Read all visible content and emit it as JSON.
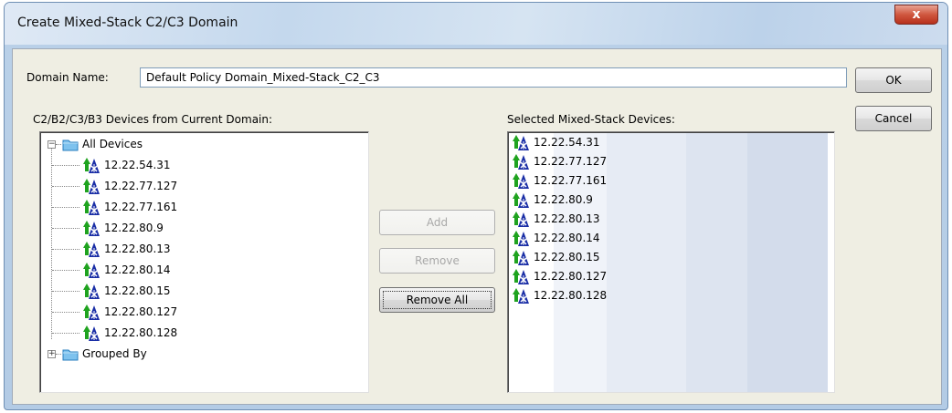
{
  "window": {
    "title": "Create Mixed-Stack C2/C3 Domain",
    "close_glyph": "x"
  },
  "form": {
    "domain_name_label": "Domain Name:",
    "domain_name_value": "Default Policy Domain_Mixed-Stack_C2_C3",
    "source_label": "C2/B2/C3/B3 Devices from Current Domain:",
    "selected_label": "Selected Mixed-Stack Devices:"
  },
  "buttons": {
    "ok": "OK",
    "cancel": "Cancel",
    "add": "Add",
    "remove": "Remove",
    "remove_all": "Remove All"
  },
  "tree": {
    "root_label": "All Devices",
    "root_expander": "−",
    "devices": [
      "12.22.54.31",
      "12.22.77.127",
      "12.22.77.161",
      "12.22.80.9",
      "12.22.80.13",
      "12.22.80.14",
      "12.22.80.15",
      "12.22.80.127",
      "12.22.80.128"
    ],
    "grouped_label": "Grouped By",
    "grouped_expander": "+"
  },
  "selected": {
    "devices": [
      "12.22.54.31",
      "12.22.77.127",
      "12.22.77.161",
      "12.22.80.9",
      "12.22.80.13",
      "12.22.80.14",
      "12.22.80.15",
      "12.22.80.127",
      "12.22.80.128"
    ]
  },
  "icons": {
    "device": "switch-stack-icon",
    "folder": "folder-icon"
  },
  "colors": {
    "icon_arrow": "#1fa31f",
    "icon_body": "#1a2ea6",
    "folder_fill": "#7ec2ee"
  }
}
